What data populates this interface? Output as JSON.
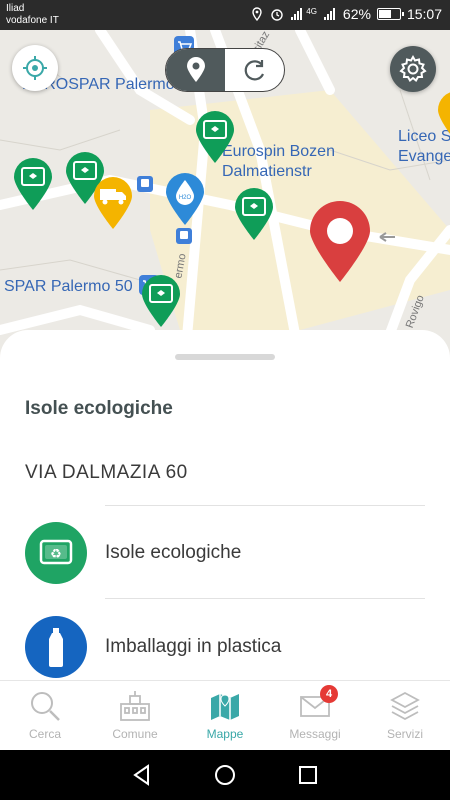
{
  "status_bar": {
    "carrier_1": "Iliad",
    "carrier_2": "vodafone IT",
    "network": "4G",
    "battery_percent": "62%",
    "battery_level": 0.62,
    "time": "15:07"
  },
  "map": {
    "labels": {
      "eurospar_top": "EUROSPAR Palermo 50",
      "eurospin": "Eurospin Bozen",
      "dalmatienstr": "Dalmatienstr",
      "liceo_1": "Liceo S",
      "liceo_2": "Evange",
      "eurospar_bottom": "SPAR Palermo 50",
      "street_palermo": "ermo",
      "street_rovigo": "a Rovigo",
      "street_top": "sitaz"
    },
    "pin_bin_symbol": "♻",
    "pin_water_text": "H2O",
    "colors": {
      "green_pin": "#0f9d58",
      "yellow_pin": "#f4b400",
      "blue_pin": "#2d8ad8",
      "red_pin": "#d93f3f"
    }
  },
  "sheet": {
    "title": "Isole ecologiche",
    "address": "VIA DALMAZIA 60",
    "categories": [
      {
        "label": "Isole ecologiche",
        "color": "#1fa464",
        "icon": "recycle-bin-icon"
      },
      {
        "label": "Imballaggi in plastica",
        "color": "#1565c0",
        "icon": "plastic-bottle-icon"
      }
    ]
  },
  "bottom_nav": {
    "items": [
      {
        "label": "Cerca",
        "icon": "search-icon"
      },
      {
        "label": "Comune",
        "icon": "town-hall-icon"
      },
      {
        "label": "Mappe",
        "icon": "map-icon",
        "active": true
      },
      {
        "label": "Messaggi",
        "icon": "mail-icon",
        "badge": "4"
      },
      {
        "label": "Servizi",
        "icon": "layers-icon"
      }
    ]
  }
}
